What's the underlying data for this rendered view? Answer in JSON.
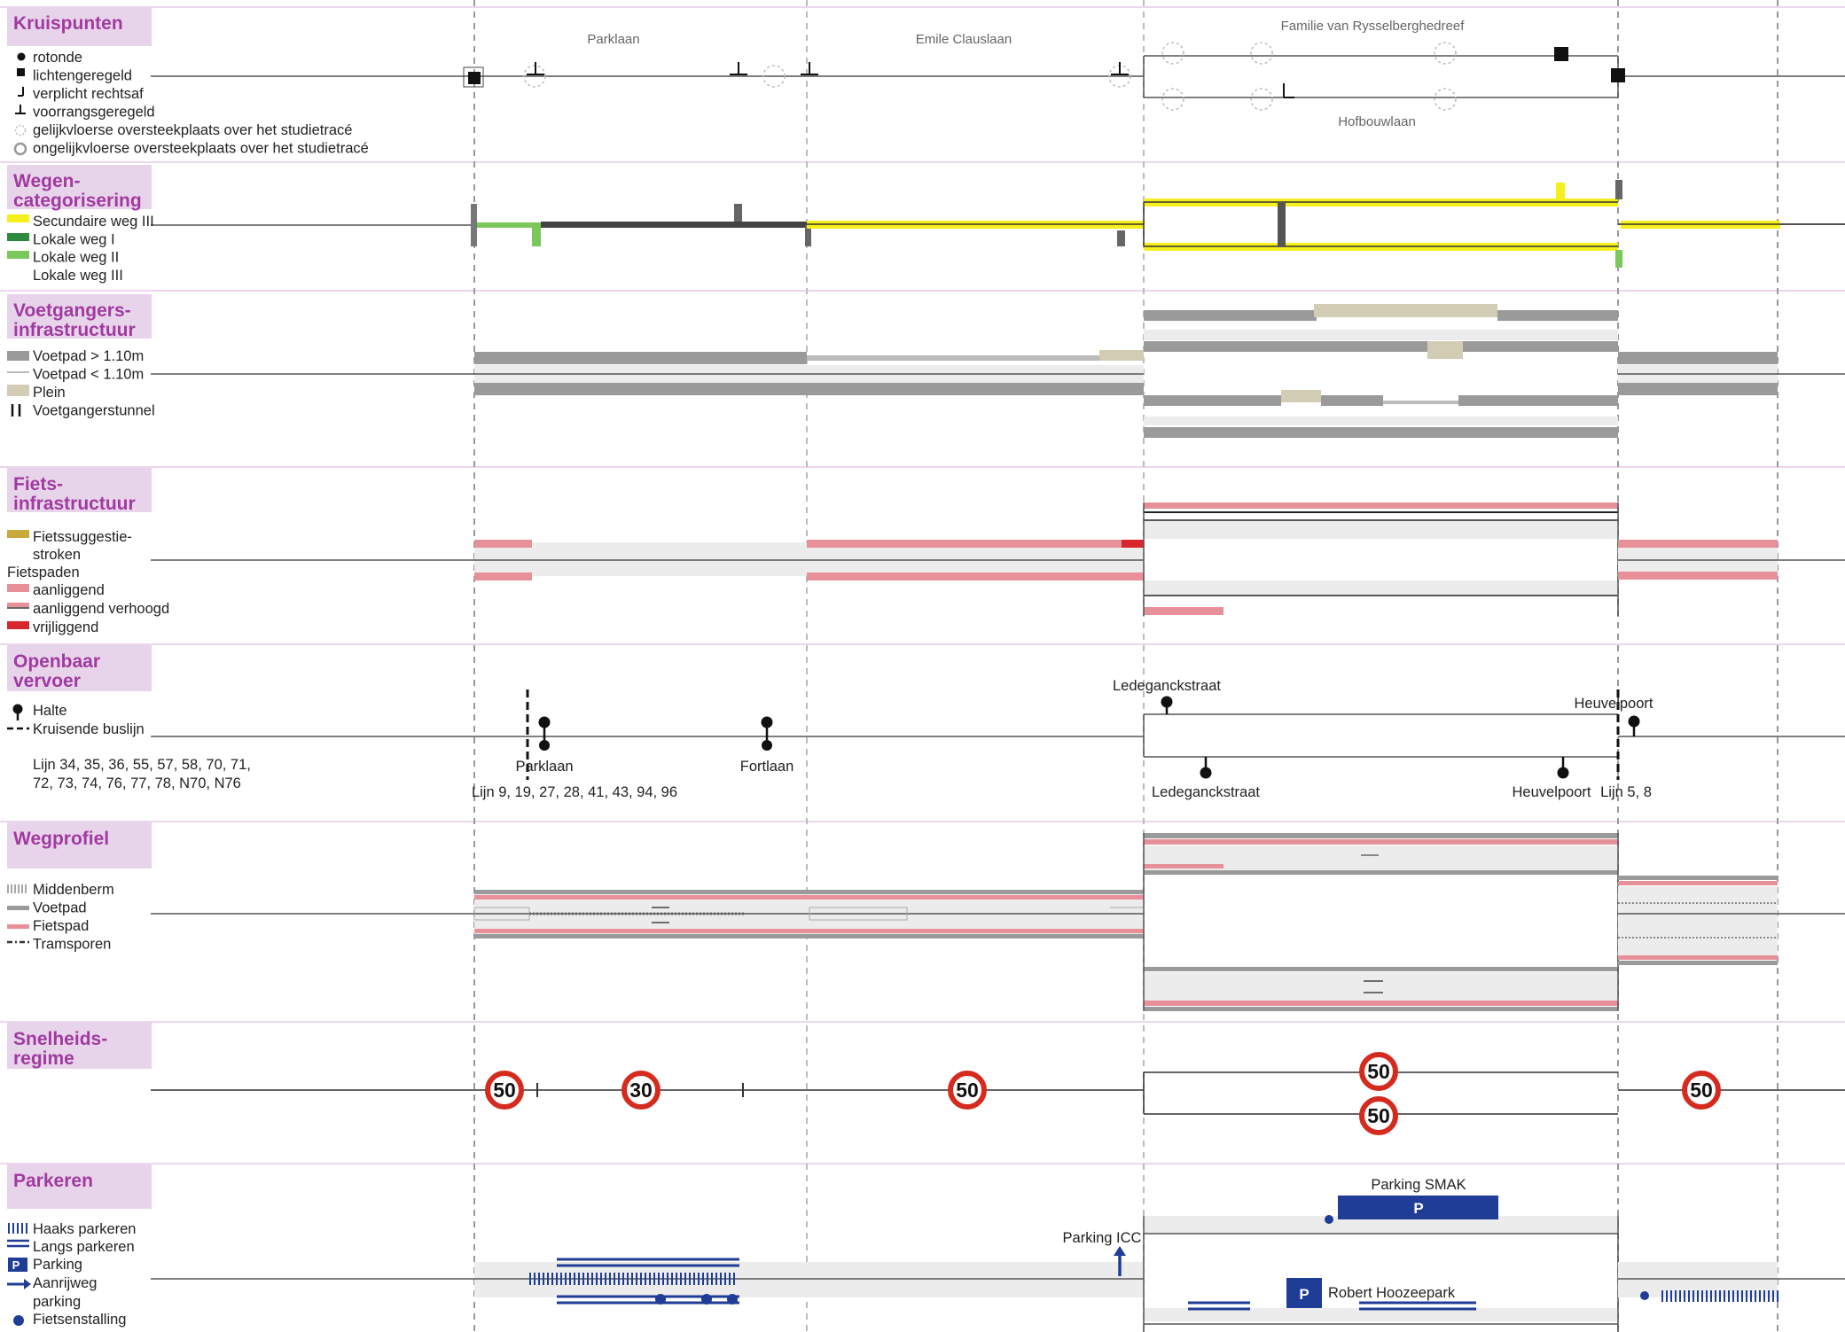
{
  "sections": {
    "kruispunten": {
      "title": [
        "Kruispunten"
      ],
      "legend": [
        "rotonde",
        "lichtengeregeld",
        "verplicht rechtsaf",
        "voorrangsgeregeld",
        "gelijkvloerse oversteekplaats over het studietracé",
        "ongelijkvloerse oversteekplaats over het studietracé"
      ],
      "streets": {
        "parklaan": "Parklaan",
        "emile": "Emile Clauslaan",
        "familie": "Familie van Rysselberghedreef",
        "hofbouw": "Hofbouwlaan"
      }
    },
    "wegen": {
      "title": [
        "Wegen-",
        "categorisering"
      ],
      "legend": [
        "Secundaire weg III",
        "Lokale weg I",
        "Lokale weg II",
        "Lokale weg III"
      ]
    },
    "voetgangers": {
      "title": [
        "Voetgangers-",
        "infrastructuur"
      ],
      "legend": [
        "Voetpad > 1.10m",
        "Voetpad < 1.10m",
        "Plein",
        "Voetgangerstunnel"
      ]
    },
    "fiets": {
      "title": [
        "Fiets-",
        "infrastructuur"
      ],
      "legend": [
        "Fietssuggestie-",
        "stroken",
        "Fietspaden",
        "aanliggend",
        "aanliggend verhoogd",
        "vrijliggend"
      ]
    },
    "ov": {
      "title": [
        "Openbaar",
        "vervoer"
      ],
      "legend": [
        "Halte",
        "Kruisende buslijn"
      ],
      "lines": [
        "Lijn 34, 35, 36, 55, 57, 58, 70, 71,",
        "72, 73, 74, 76, 77, 78, N70, N76"
      ],
      "labels": {
        "parklaan": "Parklaan",
        "fortlaan": "Fortlaan",
        "lijn_parklaan": "Lijn 9, 19, 27, 28, 41, 43, 94, 96",
        "ledeganck_top": "Ledeganckstraat",
        "ledeganck_bottom": "Ledeganckstraat",
        "heuvelpoort_top": "Heuvelpoort",
        "heuvelpoort_bottom": "Heuvelpoort",
        "lijn58": "Lijn 5, 8"
      }
    },
    "wegprofiel": {
      "title": [
        "Wegprofiel"
      ],
      "legend": [
        "Middenberm",
        "Voetpad",
        "Fietspad",
        "Tramsporen"
      ]
    },
    "snelheid": {
      "title": [
        "Snelheids-",
        "regime"
      ],
      "signs": [
        "50",
        "30",
        "50",
        "50",
        "50",
        "50"
      ]
    },
    "parkeren": {
      "title": [
        "Parkeren"
      ],
      "legend": [
        "Haaks parkeren",
        "Langs parkeren",
        "Parking",
        "Aanrijweg",
        "parking",
        "Fietsenstalling"
      ],
      "labels": {
        "smak": "Parking SMAK",
        "icc": "Parking ICC",
        "hooze": "Robert Hoozeepark",
        "p": "P"
      }
    }
  },
  "colors": {
    "title_text": "#a03aa0",
    "title_bg": "#e8d4ea",
    "separator": "#e6c8e8",
    "secundaire": "#f5ef1c",
    "lokaal1": "#2f8a3e",
    "lokaal2": "#7bc85a",
    "lokaal3": "#444444",
    "voetpad": "#9a9a9a",
    "plein": "#d2ccb4",
    "fietssuggestie": "#c8a93a",
    "fiets_aanliggend": "#e8909a",
    "fiets_vrij": "#d7262e",
    "sign_red": "#d52b1e",
    "parking_blue": "#1f3c96",
    "band": "#ececec"
  }
}
